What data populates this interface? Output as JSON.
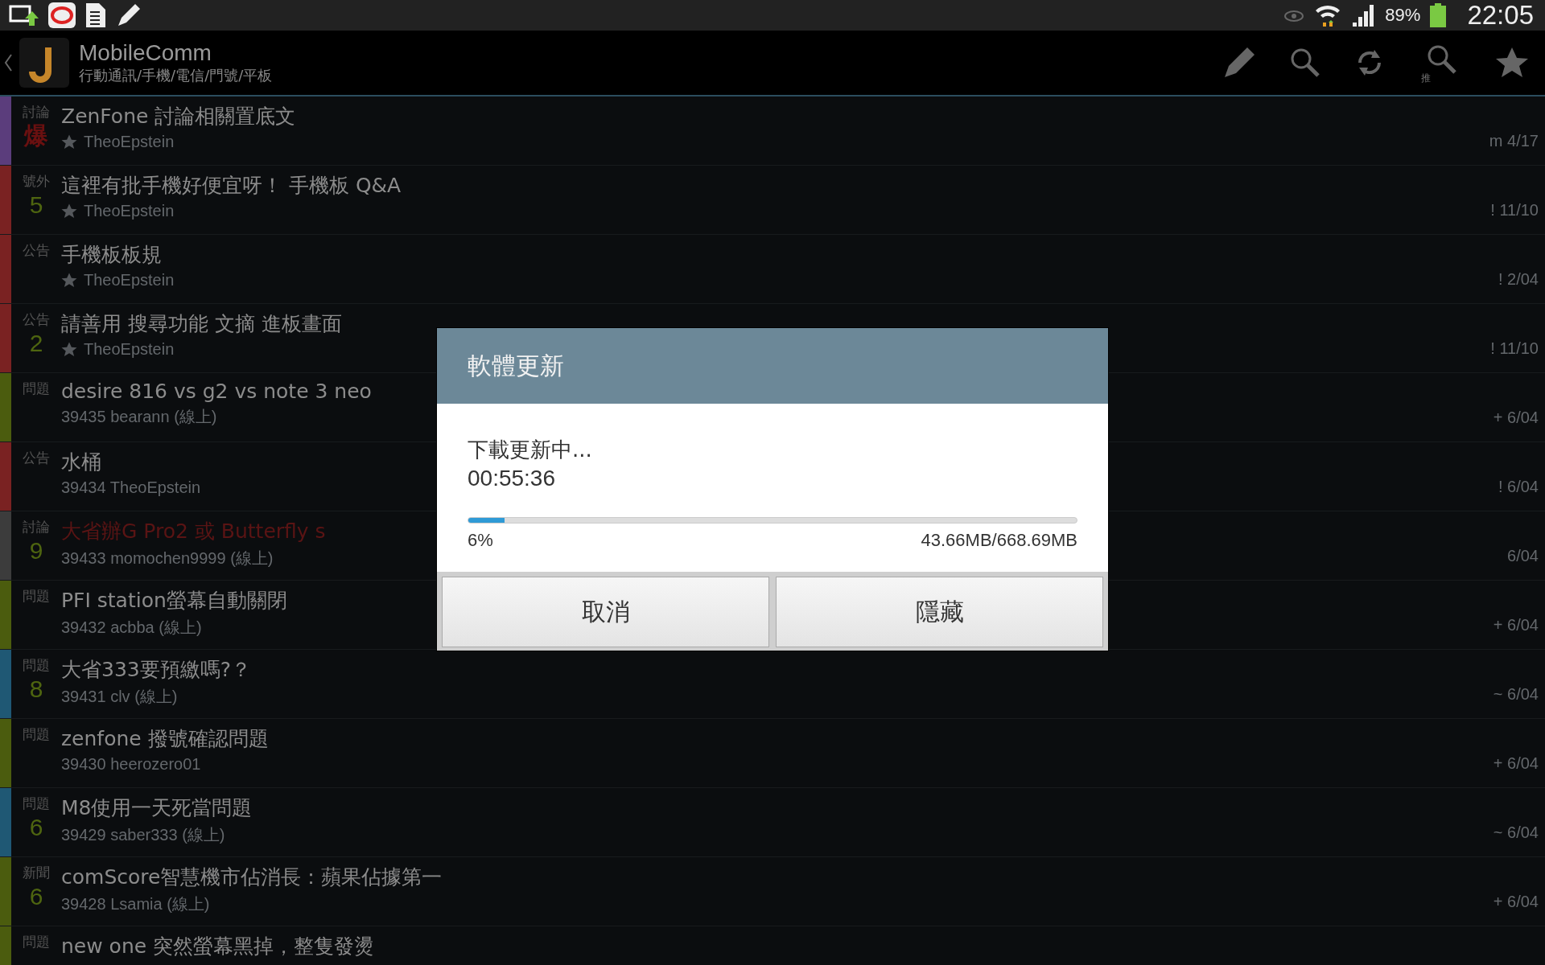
{
  "status_bar": {
    "battery": "89%",
    "time": "22:05"
  },
  "action_bar": {
    "title": "MobileComm",
    "subtitle": "行動通訊/手機/電信/門號/平板",
    "push_search_label": "推"
  },
  "topics": [
    {
      "tag": "討論",
      "count": "爆",
      "hot": true,
      "title": "ZenFone 討論相關置底文",
      "highlighted": false,
      "starred": true,
      "meta": "TheoEpstein",
      "date": "m 4/17",
      "color": "#5b3d7c"
    },
    {
      "tag": "號外",
      "count": "5",
      "hot": false,
      "title": "這裡有批手機好便宜呀！ 手機板 Q&A",
      "highlighted": false,
      "starred": true,
      "meta": "TheoEpstein",
      "date": "! 11/10",
      "color": "#7a2222"
    },
    {
      "tag": "公告",
      "title": "手機板板規",
      "highlighted": false,
      "starred": true,
      "meta": "TheoEpstein",
      "date": "! 2/04",
      "color": "#7a2222"
    },
    {
      "tag": "公告",
      "count": "2",
      "hot": false,
      "title": "請善用 搜尋功能 文摘 進板畫面",
      "highlighted": false,
      "starred": true,
      "meta": "TheoEpstein",
      "date": "! 11/10",
      "color": "#7a2222"
    },
    {
      "tag": "問題",
      "title": "desire 816 vs g2 vs note 3 neo",
      "highlighted": false,
      "starred": false,
      "meta": "39435 bearann (線上)",
      "date": "+ 6/04",
      "color": "#4b5c0e"
    },
    {
      "tag": "公告",
      "title": "水桶",
      "highlighted": false,
      "starred": false,
      "meta": "39434 TheoEpstein",
      "date": "! 6/04",
      "color": "#7a2222"
    },
    {
      "tag": "討論",
      "count": "9",
      "hot": false,
      "title": "大省辦G Pro2 或 Butterfly s",
      "highlighted": true,
      "starred": false,
      "meta": "39433 momochen9999 (線上)",
      "date": "6/04",
      "color": "#3c3c3c"
    },
    {
      "tag": "問題",
      "title": "PFI station螢幕自動關閉",
      "highlighted": false,
      "starred": false,
      "meta": "39432 acbba (線上)",
      "date": "+ 6/04",
      "color": "#4b5c0e"
    },
    {
      "tag": "問題",
      "count": "8",
      "hot": false,
      "title": "大省333要預繳嗎?？",
      "highlighted": false,
      "starred": false,
      "meta": "39431 clv (線上)",
      "date": "~ 6/04",
      "color": "#1f5874"
    },
    {
      "tag": "問題",
      "title": "zenfone 撥號確認問題",
      "highlighted": false,
      "starred": false,
      "meta": "39430 heerozero01",
      "date": "+ 6/04",
      "color": "#4b5c0e"
    },
    {
      "tag": "問題",
      "count": "6",
      "hot": false,
      "title": "M8使用一天死當問題",
      "highlighted": false,
      "starred": false,
      "meta": "39429 saber333 (線上)",
      "date": "~ 6/04",
      "color": "#1f5874"
    },
    {
      "tag": "新聞",
      "count": "6",
      "hot": false,
      "title": "comScore智慧機市佔消長：蘋果佔據第一",
      "highlighted": false,
      "starred": false,
      "meta": "39428 Lsamia (線上)",
      "date": "+ 6/04",
      "color": "#4b5c0e"
    },
    {
      "tag": "問題",
      "title": "new one 突然螢幕黑掉，整隻發燙",
      "highlighted": false,
      "color": "#4b5c0e"
    }
  ],
  "dialog": {
    "title": "軟體更新",
    "message": "下載更新中...",
    "elapsed": "00:55:36",
    "level": 0.06,
    "percent": "6%",
    "size": "43.66MB/668.69MB",
    "buttons": [
      "取消",
      "隱藏"
    ]
  }
}
